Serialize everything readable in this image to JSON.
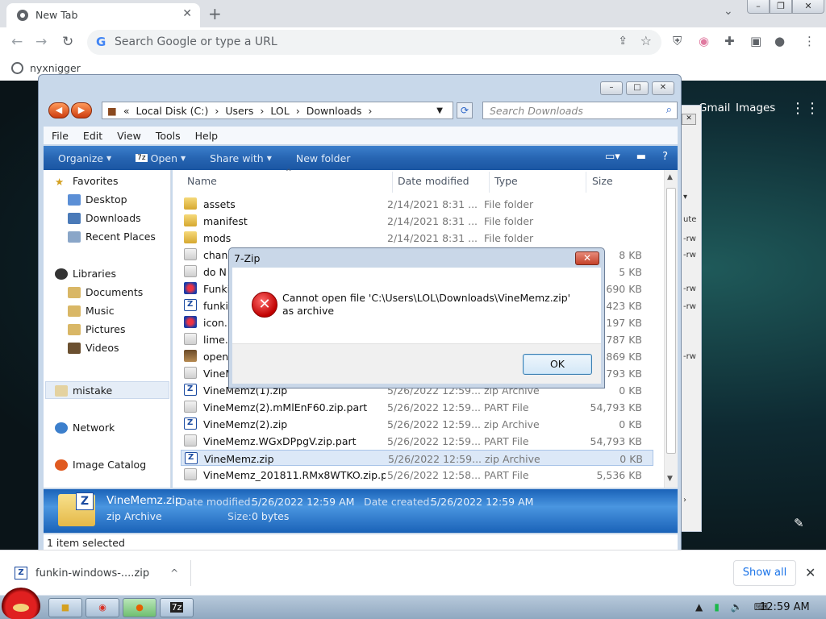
{
  "browser": {
    "tab_title": "New Tab",
    "omnibox_placeholder": "Search Google or type a URL",
    "bookmark": "nyxnigger",
    "links": {
      "gmail": "Gmail",
      "images": "Images"
    }
  },
  "explorer": {
    "address": [
      "«",
      "Local Disk (C:)",
      "›",
      "Users",
      "›",
      "LOL",
      "›",
      "Downloads",
      "›"
    ],
    "search_placeholder": "Search Downloads",
    "menu": [
      "File",
      "Edit",
      "View",
      "Tools",
      "Help"
    ],
    "commands": {
      "organize": "Organize",
      "open": "Open",
      "share": "Share with",
      "new_folder": "New folder"
    },
    "nav": {
      "favorites": "Favorites",
      "desktop": "Desktop",
      "downloads": "Downloads",
      "recent": "Recent Places",
      "libraries": "Libraries",
      "documents": "Documents",
      "music": "Music",
      "pictures": "Pictures",
      "videos": "Videos",
      "mistake": "mistake",
      "network": "Network",
      "image_catalog": "Image Catalog"
    },
    "columns": {
      "name": "Name",
      "date": "Date modified",
      "type": "Type",
      "size": "Size"
    },
    "files": [
      {
        "name": "assets",
        "date": "2/14/2021 8:31 ...",
        "type": "File folder",
        "size": ""
      },
      {
        "name": "manifest",
        "date": "2/14/2021 8:31 ...",
        "type": "File folder",
        "size": ""
      },
      {
        "name": "mods",
        "date": "2/14/2021 8:31 ...",
        "type": "File folder",
        "size": ""
      },
      {
        "name": "chang",
        "date": "",
        "type": "",
        "size": "8 KB"
      },
      {
        "name": "do N",
        "date": "",
        "type": "",
        "size": "5 KB"
      },
      {
        "name": "Funki",
        "date": "",
        "type": "",
        "size": "1,690 KB"
      },
      {
        "name": "funki",
        "date": "",
        "type": "",
        "size": "2,423 KB"
      },
      {
        "name": "icon.i",
        "date": "",
        "type": "",
        "size": "197 KB"
      },
      {
        "name": "lime.r",
        "date": "",
        "type": "",
        "size": "5,787 KB"
      },
      {
        "name": "open",
        "date": "",
        "type": "",
        "size": "3,869 KB"
      },
      {
        "name": "VineM",
        "date": "",
        "type": "",
        "size": "54,793 KB"
      },
      {
        "name": "VineMemz(1).zip",
        "date": "5/26/2022 12:59...",
        "type": "zip Archive",
        "size": "0 KB"
      },
      {
        "name": "VineMemz(2).mMlEnF60.zip.part",
        "date": "5/26/2022 12:59...",
        "type": "PART File",
        "size": "54,793 KB"
      },
      {
        "name": "VineMemz(2).zip",
        "date": "5/26/2022 12:59...",
        "type": "zip Archive",
        "size": "0 KB"
      },
      {
        "name": "VineMemz.WGxDPpgV.zip.part",
        "date": "5/26/2022 12:59...",
        "type": "PART File",
        "size": "54,793 KB"
      },
      {
        "name": "VineMemz.zip",
        "date": "5/26/2022 12:59...",
        "type": "zip Archive",
        "size": "0 KB"
      },
      {
        "name": "VineMemz_201811.RMx8WTKO.zip.p...",
        "date": "5/26/2022 12:58...",
        "type": "PART File",
        "size": "5,536 KB"
      }
    ],
    "details": {
      "filename": "VineMemz.zip",
      "type": "zip Archive",
      "modified_label": "Date modified:",
      "modified": "5/26/2022 12:59 AM",
      "created_label": "Date created:",
      "created": "5/26/2022 12:59 AM",
      "size_label": "Size:",
      "size": "0 bytes"
    },
    "status": "1 item selected"
  },
  "dialog": {
    "title": "7-Zip",
    "message": "Cannot open file 'C:\\Users\\LOL\\Downloads\\VineMemz.zip' as archive",
    "ok": "OK"
  },
  "downloads_bar": {
    "item": "funkin-windows-....zip",
    "show_all": "Show all"
  },
  "taskbar": {
    "clock": "12:59 AM"
  }
}
